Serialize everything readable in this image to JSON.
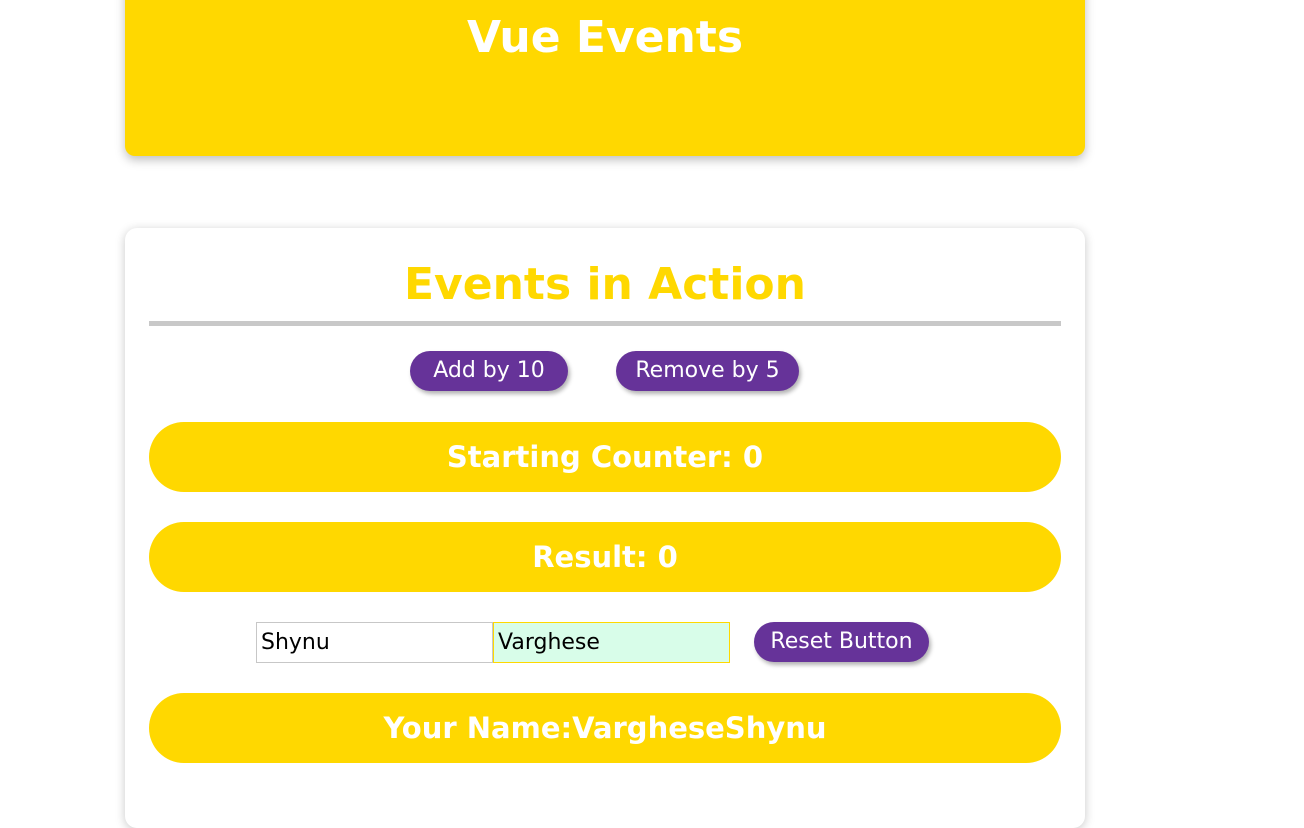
{
  "header": {
    "title": "Vue Events"
  },
  "events": {
    "title": "Events in Action",
    "add_button_label": "Add by 10",
    "remove_button_label": "Remove by 5",
    "starting_counter_text": "Starting Counter: 0",
    "result_text": "Result: 0",
    "first_name_value": "Shynu",
    "last_name_value": "Varghese",
    "reset_button_label": "Reset Button",
    "full_name_text": "Your Name:VargheseShynu"
  },
  "colors": {
    "accent_yellow": "#ffd800",
    "button_purple": "#663399",
    "active_input_bg": "#d8fde9",
    "divider_gray": "#c8c8c8"
  }
}
